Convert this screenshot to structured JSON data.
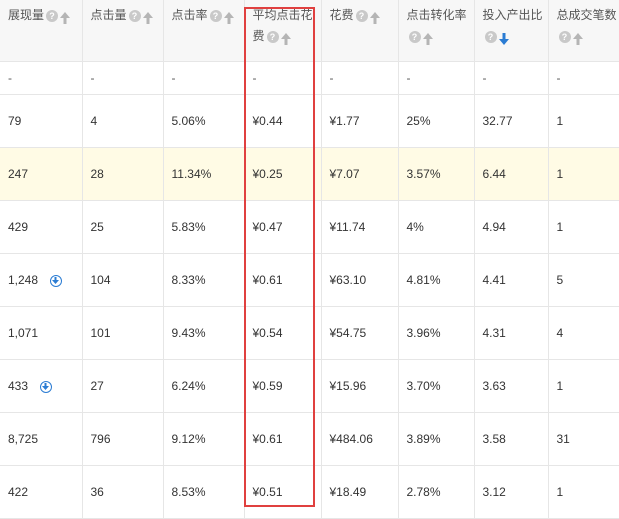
{
  "columns": [
    {
      "label": "展现量",
      "sort": "up"
    },
    {
      "label": "点击量",
      "sort": "up"
    },
    {
      "label": "点击率",
      "sort": "up"
    },
    {
      "label": "平均点击花费",
      "sort": "up"
    },
    {
      "label": "花费",
      "sort": "up"
    },
    {
      "label": "点击转化率",
      "sort": "up"
    },
    {
      "label": "投入产出比",
      "sort": "down-active"
    },
    {
      "label": "总成交笔数",
      "sort": "up"
    }
  ],
  "dash_row": [
    "-",
    "-",
    "-",
    "-",
    "-",
    "-",
    "-",
    "-"
  ],
  "rows": [
    {
      "cells": [
        "79",
        "4",
        "5.06%",
        "¥0.44",
        "¥1.77",
        "25%",
        "32.77",
        "1"
      ]
    },
    {
      "cells": [
        "247",
        "28",
        "11.34%",
        "¥0.25",
        "¥7.07",
        "3.57%",
        "6.44",
        "1"
      ],
      "highlight": true
    },
    {
      "cells": [
        "429",
        "25",
        "5.83%",
        "¥0.47",
        "¥11.74",
        "4%",
        "4.94",
        "1"
      ]
    },
    {
      "cells": [
        "1,248",
        "104",
        "8.33%",
        "¥0.61",
        "¥63.10",
        "4.81%",
        "4.41",
        "5"
      ],
      "download_icon": true
    },
    {
      "cells": [
        "1,071",
        "101",
        "9.43%",
        "¥0.54",
        "¥54.75",
        "3.96%",
        "4.31",
        "4"
      ]
    },
    {
      "cells": [
        "433",
        "27",
        "6.24%",
        "¥0.59",
        "¥15.96",
        "3.70%",
        "3.63",
        "1"
      ],
      "download_icon": true
    },
    {
      "cells": [
        "8,725",
        "796",
        "9.12%",
        "¥0.61",
        "¥484.06",
        "3.89%",
        "3.58",
        "31"
      ]
    },
    {
      "cells": [
        "422",
        "36",
        "8.53%",
        "¥0.51",
        "¥18.49",
        "2.78%",
        "3.12",
        "1"
      ]
    }
  ],
  "colors": {
    "highlight_box": "#e0403f",
    "active_sort": "#2b7cd3",
    "row_highlight": "#fffbe5"
  },
  "icons": {
    "help": "question-icon",
    "sort": "sort-arrow-icon",
    "download": "download-circle-icon"
  }
}
